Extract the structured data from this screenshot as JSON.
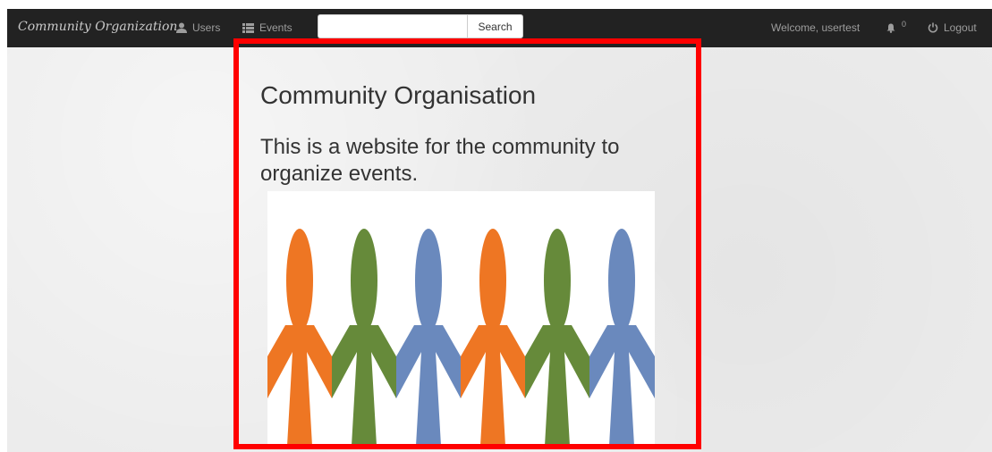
{
  "navbar": {
    "brand": "Community Organization",
    "links": [
      {
        "label": "Users",
        "icon": "user-icon"
      },
      {
        "label": "Events",
        "icon": "list-icon"
      }
    ],
    "search": {
      "value": "",
      "placeholder": "",
      "button_label": "Search"
    },
    "welcome_text": "Welcome, usertest",
    "notifications": {
      "icon": "bell-icon",
      "count": "0"
    },
    "logout": {
      "label": "Logout",
      "icon": "power-icon"
    }
  },
  "main": {
    "title": "Community Organisation",
    "subtitle": "This is a website for the community to organize events."
  },
  "colors": {
    "navbar_bg": "#222222",
    "figure_orange": "#ee7623",
    "figure_green": "#668a3a",
    "figure_blue": "#6a89bd",
    "highlight": "#ff0000"
  }
}
